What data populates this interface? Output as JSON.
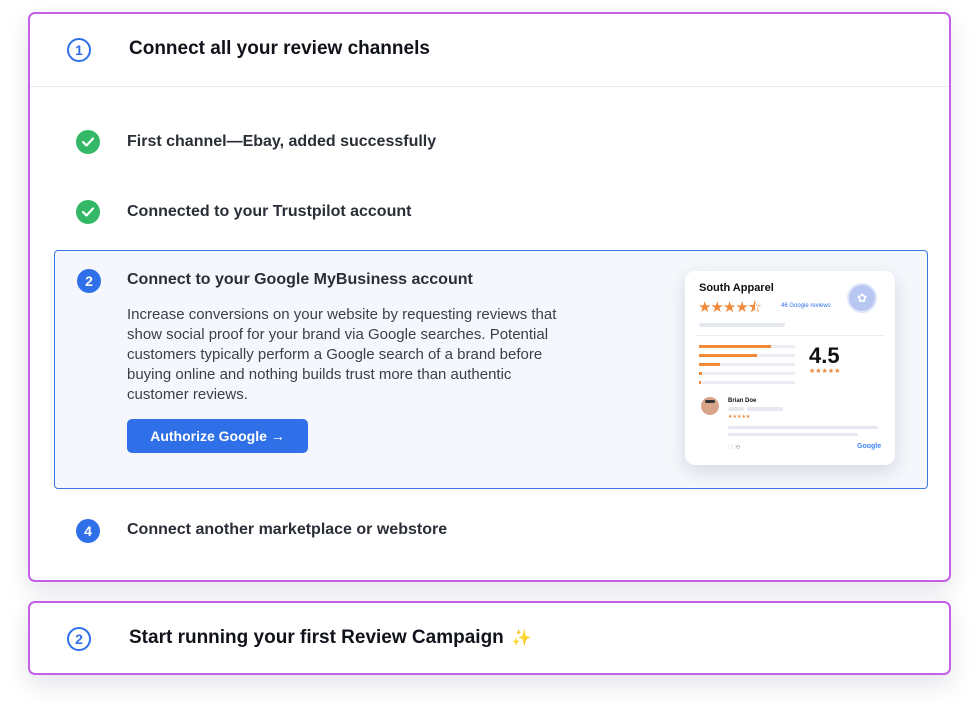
{
  "section1": {
    "number": "1",
    "title": "Connect all your review channels",
    "steps": [
      {
        "text": "First channel—Ebay, added successfully",
        "status": "done"
      },
      {
        "text": "Connected to your Trustpilot account",
        "status": "done"
      }
    ],
    "active_step": {
      "number": "2",
      "title": "Connect to your Google MyBusiness account",
      "description": "Increase conversions on your website by requesting reviews that show social proof for your brand via Google searches. Potential customers typically perform a Google search of a brand before buying online and nothing builds trust more than authentic customer reviews.",
      "button_label": "Authorize Google →",
      "preview": {
        "business_name": "South Apparel",
        "stars": "★★★★⯪",
        "reviews_link": "46 Google reviews",
        "score": "4.5",
        "score_stars": "★★★★★",
        "rating_bars": [
          0.75,
          0.6,
          0.22,
          0.03,
          0.02
        ],
        "reviewer_name": "Brian Doe",
        "reviewer_stars": "★★★★★",
        "source": "Google"
      }
    },
    "next_step": {
      "number": "4",
      "text": "Connect another marketplace or webstore"
    }
  },
  "section2": {
    "number": "2",
    "title": "Start running your first Review Campaign",
    "emoji": "✨"
  },
  "colors": {
    "card_border": "#c45fe6",
    "accent": "#2f6fe8",
    "success": "#34b867",
    "star": "#f08a3a"
  }
}
